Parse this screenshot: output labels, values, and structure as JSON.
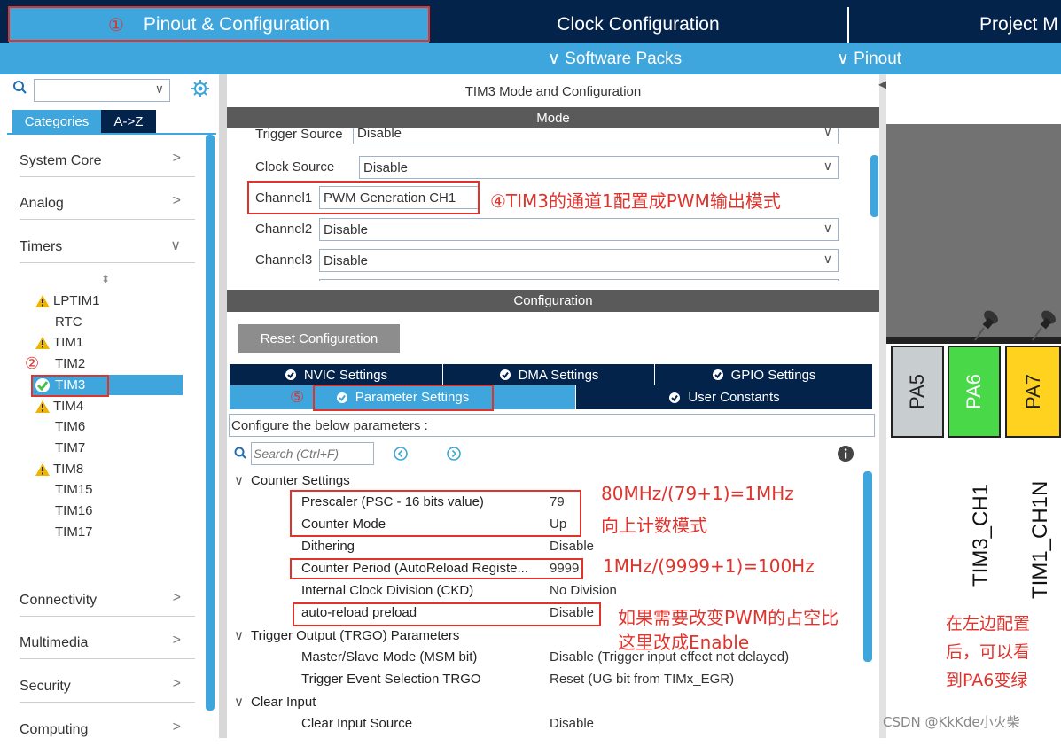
{
  "top_tabs": {
    "pinout": "Pinout & Configuration",
    "pinout_marker": "①",
    "clock": "Clock Configuration",
    "project": "Project M"
  },
  "sub_bar": {
    "software_packs": "∨ Software Packs",
    "pinout": "∨ Pinout"
  },
  "left": {
    "search_value": "",
    "tab_categories": "Categories",
    "tab_az": "A->Z",
    "categories": [
      "System Core",
      "Analog",
      "Timers"
    ],
    "bottom_categories": [
      "Connectivity",
      "Multimedia",
      "Security",
      "Computing"
    ],
    "timers": [
      {
        "name": "LPTIM1",
        "icon": "warning-icon"
      },
      {
        "name": "RTC",
        "icon": ""
      },
      {
        "name": "TIM1",
        "icon": "warning-icon"
      },
      {
        "name": "TIM2",
        "icon": ""
      },
      {
        "name": "TIM3",
        "icon": "check-icon"
      },
      {
        "name": "TIM4",
        "icon": "warning-icon"
      },
      {
        "name": "TIM6",
        "icon": ""
      },
      {
        "name": "TIM7",
        "icon": ""
      },
      {
        "name": "TIM8",
        "icon": "warning-icon"
      },
      {
        "name": "TIM15",
        "icon": ""
      },
      {
        "name": "TIM16",
        "icon": ""
      },
      {
        "name": "TIM17",
        "icon": ""
      }
    ],
    "marker_2": "②"
  },
  "mode": {
    "title": "TIM3 Mode and Configuration",
    "mode_header": "Mode",
    "trigger_label": "Trigger Source",
    "trigger_value": "Disable",
    "clock_label": "Clock Source",
    "clock_value": "Disable",
    "ch1_label": "Channel1",
    "ch1_value": "PWM Generation CH1",
    "ch2_label": "Channel2",
    "ch2_value": "Disable",
    "ch3_label": "Channel3",
    "ch3_value": "Disable"
  },
  "config": {
    "header": "Configuration",
    "reset_button": "Reset Configuration",
    "tab_nvic": "NVIC Settings",
    "tab_dma": "DMA Settings",
    "tab_gpio": "GPIO Settings",
    "tab_param": "Parameter Settings",
    "tab_user": "User Constants",
    "marker_5": "⑤",
    "desc": "Configure the below parameters :",
    "search_placeholder": "Search (Ctrl+F)",
    "groups": {
      "counter": "Counter Settings",
      "trigger_out": "Trigger Output (TRGO) Parameters",
      "clear_input": "Clear Input"
    },
    "params": [
      {
        "name": "Prescaler (PSC - 16 bits value)",
        "value": "79"
      },
      {
        "name": "Counter Mode",
        "value": "Up"
      },
      {
        "name": "Dithering",
        "value": "Disable"
      },
      {
        "name": "Counter Period (AutoReload Registe...",
        "value": "9999"
      },
      {
        "name": "Internal Clock Division (CKD)",
        "value": "No Division"
      },
      {
        "name": "auto-reload preload",
        "value": "Disable"
      },
      {
        "name": "Master/Slave Mode (MSM bit)",
        "value": "Disable (Trigger input effect not delayed)"
      },
      {
        "name": "Trigger Event Selection TRGO",
        "value": "Reset (UG bit from TIMx_EGR)"
      },
      {
        "name": "Clear Input Source",
        "value": "Disable"
      }
    ]
  },
  "annotations": {
    "a4": "④TIM3的通道1配置成PWM输出模式",
    "a_psc": "80MHz/(79+1)=1MHz",
    "a_mode": "向上计数模式",
    "a_period": "1MHz/(9999+1)=100Hz",
    "a_preload1": "如果需要改变PWM的占空比",
    "a_preload2": "这里改成Enable",
    "a_right1": "在左边配置",
    "a_right2": "后，可以看",
    "a_right3": "到PA6变绿"
  },
  "pins": {
    "pa5": "PA5",
    "pa6": "PA6",
    "pa7": "PA7",
    "label_tim3": "TIM3_CH1",
    "label_tim1": "TIM1_CH1N"
  },
  "watermark": "CSDN @KkKde小火柴",
  "colors": {
    "navy": "#03234b",
    "blue": "#3ea6dc",
    "red": "#e0332c",
    "green": "#48d848",
    "yellow": "#ffd21f"
  }
}
